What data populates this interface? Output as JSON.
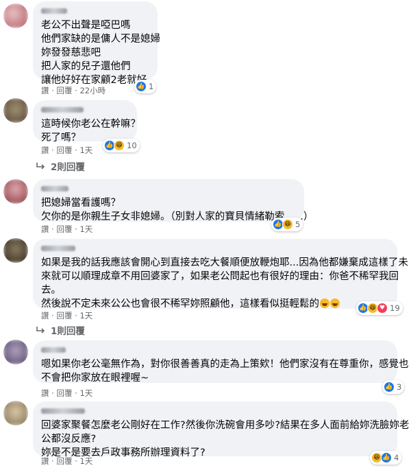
{
  "comments": [
    {
      "lines": [
        "老公不出聲是啞巴嗎",
        "他們家缺的是傭人不是媳婦",
        "妳發發慈悲吧",
        "把人家的兒子還他們",
        "讓他好好在家顧2老就好"
      ],
      "meta": {
        "like": "讚",
        "sep1": " · ",
        "reply": "回覆",
        "sep2": " · ",
        "time": "22小時"
      },
      "reactions": {
        "types": [
          "like"
        ],
        "count": "1"
      },
      "avatar_color": "#d9a0a8"
    },
    {
      "lines": [
        "這時候你老公在幹嘛？",
        "死了嗎？"
      ],
      "meta": {
        "like": "讚",
        "sep1": " · ",
        "reply": "回覆",
        "sep2": " · ",
        "time": "1天"
      },
      "reactions": {
        "types": [
          "like",
          "haha"
        ],
        "count": "10"
      },
      "replies": "2則回覆",
      "avatar_color": "#8a7a60"
    },
    {
      "lines": [
        "把媳婦當看護嗎？",
        "欠你的是你親生子女非媳婦。（別對人家的寶貝情緒勒索......）"
      ],
      "meta": {
        "like": "讚",
        "sep1": " · ",
        "reply": "回覆",
        "sep2": " · ",
        "time": "1天"
      },
      "reactions": {
        "types": [
          "like",
          "haha"
        ],
        "count": "5"
      },
      "avatar_color": "#c47a80"
    },
    {
      "lines": [
        "如果是我的話我應該會開心到直接去吃大餐順便放鞭炮耶...因為他都嫌棄成這樣了未",
        "來就可以順理成章不用回婆家了，如果老公問起也有很好的理由：你爸不稀罕我回",
        "去。",
        "然後說不定未來公公也會很不稀罕妳照顧他，這樣看似挺輕鬆的"
      ],
      "meta": {
        "like": "讚",
        "sep1": " · ",
        "reply": "回覆",
        "sep2": " · ",
        "time": "1天"
      },
      "reactions": {
        "types": [
          "like",
          "haha",
          "love"
        ],
        "count": "19"
      },
      "replies": "1則回覆",
      "avatar_color": "#7a6a55"
    },
    {
      "lines": [
        "嗯如果你老公毫無作為，對你很善善真的走為上策欸！他們家沒有在尊重你，感覺也",
        "不會把你家放在眼裡喔~"
      ],
      "meta": {
        "like": "讚",
        "sep1": " · ",
        "reply": "回覆",
        "sep2": " · ",
        "time": "1天"
      },
      "reactions": {
        "types": [
          "like"
        ],
        "count": "3"
      },
      "avatar_color": "#9a8fa8"
    },
    {
      "lines": [
        "回婆家聚餐怎麼老公剛好在工作?然後你洗碗會用多吵?結果在多人面前給妳洗臉妳老",
        "公都沒反應?",
        "妳是不是要去戶政事務所辦理資料了?"
      ],
      "meta": {
        "like": "讚",
        "sep1": " · ",
        "reply": "回覆",
        "sep2": " · ",
        "time": "1天"
      },
      "reactions": {
        "types": [
          "haha",
          "like"
        ],
        "count": "4"
      },
      "avatar_color": "#b8a890"
    }
  ]
}
